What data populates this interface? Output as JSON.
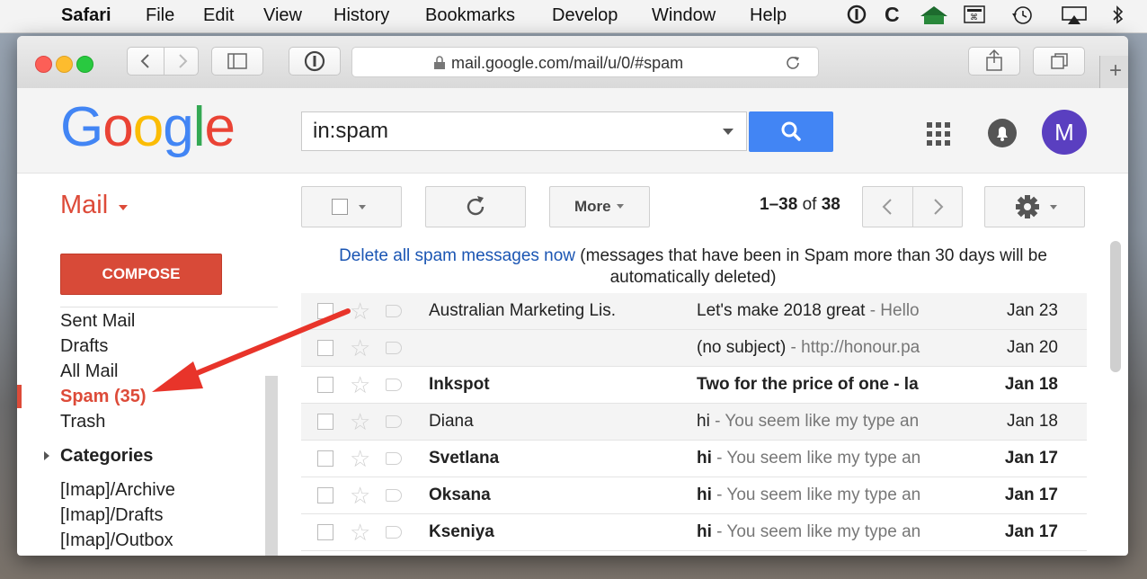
{
  "menubar": {
    "app_name": "Safari",
    "items": [
      "File",
      "Edit",
      "View",
      "History",
      "Bookmarks",
      "Develop",
      "Window",
      "Help"
    ]
  },
  "browser": {
    "url": "mail.google.com/mail/u/0/#spam"
  },
  "gmail": {
    "logo_text": "Google",
    "search_value": "in:spam",
    "avatar_letter": "M",
    "mail_label": "Mail",
    "more_label": "More",
    "pager_range": "1–38",
    "pager_of": "of",
    "pager_total": "38",
    "compose_label": "COMPOSE",
    "nav": {
      "sent": "Sent Mail",
      "drafts": "Drafts",
      "all": "All Mail",
      "spam": "Spam (35)",
      "trash": "Trash",
      "categories": "Categories",
      "imap_archive": "[Imap]/Archive",
      "imap_drafts": "[Imap]/Drafts",
      "imap_outbox": "[Imap]/Outbox"
    },
    "notice": {
      "link": "Delete all spam messages now",
      "text": " (messages that have been in Spam more than 30 days will be automatically deleted)"
    },
    "messages": [
      {
        "sender": "Australian Marketing Lis.",
        "subject": "Let's make 2018 great",
        "snippet": " - Hello",
        "date": "Jan 23",
        "unread": false
      },
      {
        "sender": "",
        "subject": "(no subject)",
        "snippet": " - http://honour.pa",
        "date": "Jan 20",
        "unread": false
      },
      {
        "sender": "Inkspot",
        "subject": "Two for the price of one - la",
        "snippet": "",
        "date": "Jan 18",
        "unread": true
      },
      {
        "sender": "Diana",
        "subject": "hi",
        "snippet": " - You seem like my type an",
        "date": "Jan 18",
        "unread": false
      },
      {
        "sender": "Svetlana",
        "subject": "hi",
        "snippet": " - You seem like my type an",
        "date": "Jan 17",
        "unread": true
      },
      {
        "sender": "Oksana",
        "subject": "hi",
        "snippet": " - You seem like my type an",
        "date": "Jan 17",
        "unread": true
      },
      {
        "sender": "Kseniya",
        "subject": "hi",
        "snippet": " - You seem like my type an",
        "date": "Jan 17",
        "unread": true
      }
    ]
  },
  "colors": {
    "gmail_red": "#dd4b39",
    "google_blue": "#4285f4",
    "link_blue": "#1a55b3",
    "annotation_arrow": "#e8342a"
  }
}
